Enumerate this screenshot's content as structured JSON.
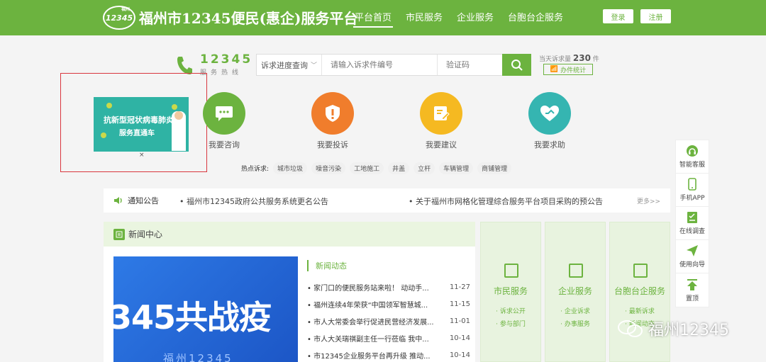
{
  "header": {
    "logo_text": "12345",
    "logo_small": "福州",
    "title": "福州市12345便民(惠企)服务平台",
    "nav": [
      "平台首页",
      "市民服务",
      "企业服务",
      "台胞台企服务"
    ],
    "login": "登录",
    "register": "注册"
  },
  "hotline": {
    "number": "12345",
    "label": "服务热线"
  },
  "search": {
    "select": "诉求进度查询",
    "placeholder": "请输入诉求件编号",
    "code_placeholder": "验证码"
  },
  "today": {
    "label": "当天诉求量",
    "count": "230",
    "unit": "件",
    "stat_button": "办件统计"
  },
  "banner": {
    "line1": "抗新型冠状病毒肺炎",
    "line2": "服务直通车",
    "close": "×"
  },
  "services": [
    {
      "label": "我要咨询",
      "color": "#6cb33f"
    },
    {
      "label": "我要投诉",
      "color": "#f07d2c"
    },
    {
      "label": "我要建议",
      "color": "#f5b921"
    },
    {
      "label": "我要求助",
      "color": "#35b5b1"
    }
  ],
  "hot": {
    "title": "热点诉求:",
    "tags": [
      "城市垃圾",
      "噪音污染",
      "工地施工",
      "井盖",
      "立杆",
      "车辆管理",
      "商铺管理"
    ]
  },
  "sidebar": [
    "智能客服",
    "手机APP",
    "在线调查",
    "使用向导",
    "置顶"
  ],
  "notice": {
    "title": "通知公告",
    "items": [
      "• 福州市12345政府公共服务系统更名公告",
      "• 关于福州市网格化管理综合服务平台项目采购的预公告"
    ],
    "more": "更多>>"
  },
  "news": {
    "title": "新闻中心",
    "image_text": "345共战疫",
    "image_sub": "福州12345",
    "list_title": "新闻动态",
    "items": [
      {
        "text": "• 家门口的便民服务站来啦！ 动动手...",
        "date": "11-27"
      },
      {
        "text": "• 福州连续4年荣获“中国领军智慧城...",
        "date": "11-15"
      },
      {
        "text": "• 市人大常委会举行促进民营经济发展...",
        "date": "11-01"
      },
      {
        "text": "• 市人大关瑞祺副主任一行莅临 我中...",
        "date": "10-14"
      },
      {
        "text": "• 市12345企业服务平台再升级 推动...",
        "date": "10-14"
      }
    ]
  },
  "cards": [
    {
      "title": "市民服务",
      "links": [
        "· 诉求公开",
        "· 参与部门"
      ]
    },
    {
      "title": "企业服务",
      "links": [
        "· 企业诉求",
        "· 办事服务"
      ]
    },
    {
      "title": "台胞台企服务",
      "links": [
        "· 最新诉求",
        "· 新闻动态"
      ]
    }
  ],
  "watermark": "福州12345",
  "colors": {
    "brand": "#6cb33f",
    "highlight": "#d9363e"
  }
}
